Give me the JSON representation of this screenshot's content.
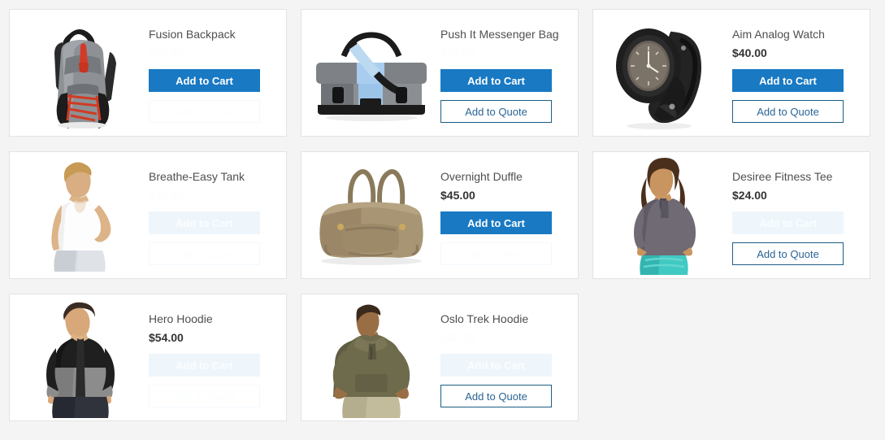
{
  "page": {
    "background_color": "#f4f4f4",
    "card_background": "#ffffff",
    "accent_blue": "#1979c3",
    "quote_border_blue": "#1b5e84",
    "quote_text_blue": "#2a6496"
  },
  "labels": {
    "add_to_cart": "Add to Cart",
    "add_to_quote": "Add to Quote"
  },
  "products": [
    {
      "name": "Fusion Backpack",
      "price": "$59.00",
      "price_faded": true,
      "cart_faded": false,
      "quote_faded": true,
      "image": "backpack"
    },
    {
      "name": "Push It Messenger Bag",
      "price": "$45.00",
      "price_faded": true,
      "cart_faded": false,
      "quote_faded": false,
      "image": "messenger-bag"
    },
    {
      "name": "Aim Analog Watch",
      "price": "$40.00",
      "price_faded": false,
      "cart_faded": false,
      "quote_faded": false,
      "image": "watch"
    },
    {
      "name": "Breathe-Easy Tank",
      "price": "$34.00",
      "price_faded": true,
      "cart_faded": true,
      "quote_faded": true,
      "image": "tank-top-model"
    },
    {
      "name": "Overnight Duffle",
      "price": "$45.00",
      "price_faded": false,
      "cart_faded": false,
      "quote_faded": true,
      "image": "duffle-bag"
    },
    {
      "name": "Desiree Fitness Tee",
      "price": "$24.00",
      "price_faded": false,
      "cart_faded": true,
      "quote_faded": false,
      "image": "fitness-tee-model"
    },
    {
      "name": "Hero Hoodie",
      "price": "$54.00",
      "price_faded": false,
      "cart_faded": true,
      "quote_faded": true,
      "image": "hero-hoodie-model"
    },
    {
      "name": "Oslo Trek Hoodie",
      "price": "$42.00",
      "price_faded": true,
      "cart_faded": true,
      "quote_faded": false,
      "image": "trek-hoodie-model"
    }
  ]
}
